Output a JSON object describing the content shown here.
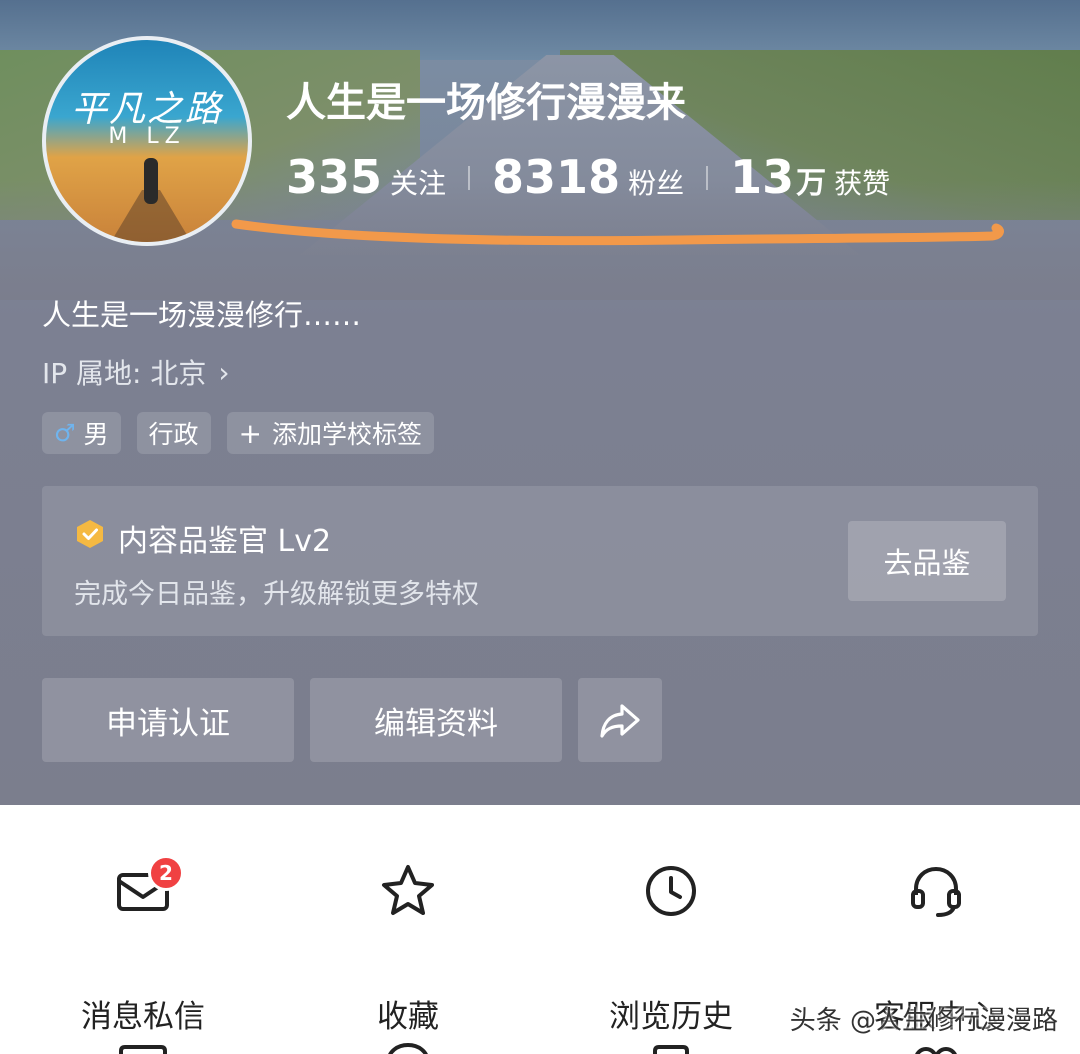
{
  "avatar": {
    "title": "平凡之路",
    "subtitle": "M LZ"
  },
  "profile": {
    "name": "人生是一场修行漫漫来",
    "bio": "人生是一场漫漫修行……",
    "ip_location": "IP 属地: 北京"
  },
  "stats": [
    {
      "number": "335",
      "unit": "",
      "label": "关注"
    },
    {
      "number": "8318",
      "unit": "",
      "label": "粉丝"
    },
    {
      "number": "13",
      "unit": "万",
      "label": "获赞"
    }
  ],
  "tags": {
    "gender": "男",
    "gender_icon": "male-icon",
    "job": "行政",
    "add_school": "添加学校标签"
  },
  "reviewer_card": {
    "title": "内容品鉴官 Lv2",
    "subtitle": "完成今日品鉴，升级解锁更多特权",
    "button": "去品鉴",
    "badge_color": "#f5b942"
  },
  "actions": {
    "apply_verify": "申请认证",
    "edit_profile": "编辑资料",
    "share_icon": "share-icon"
  },
  "functions": [
    {
      "label": "消息私信",
      "icon": "mail-icon",
      "badge": "2"
    },
    {
      "label": "收藏",
      "icon": "star-icon"
    },
    {
      "label": "浏览历史",
      "icon": "clock-icon"
    },
    {
      "label": "客服中心",
      "icon": "headset-icon"
    }
  ],
  "colors": {
    "badge_red": "#f04142",
    "highlight_stroke": "#f2994a"
  },
  "watermark": "头条 @人生修行漫漫路"
}
